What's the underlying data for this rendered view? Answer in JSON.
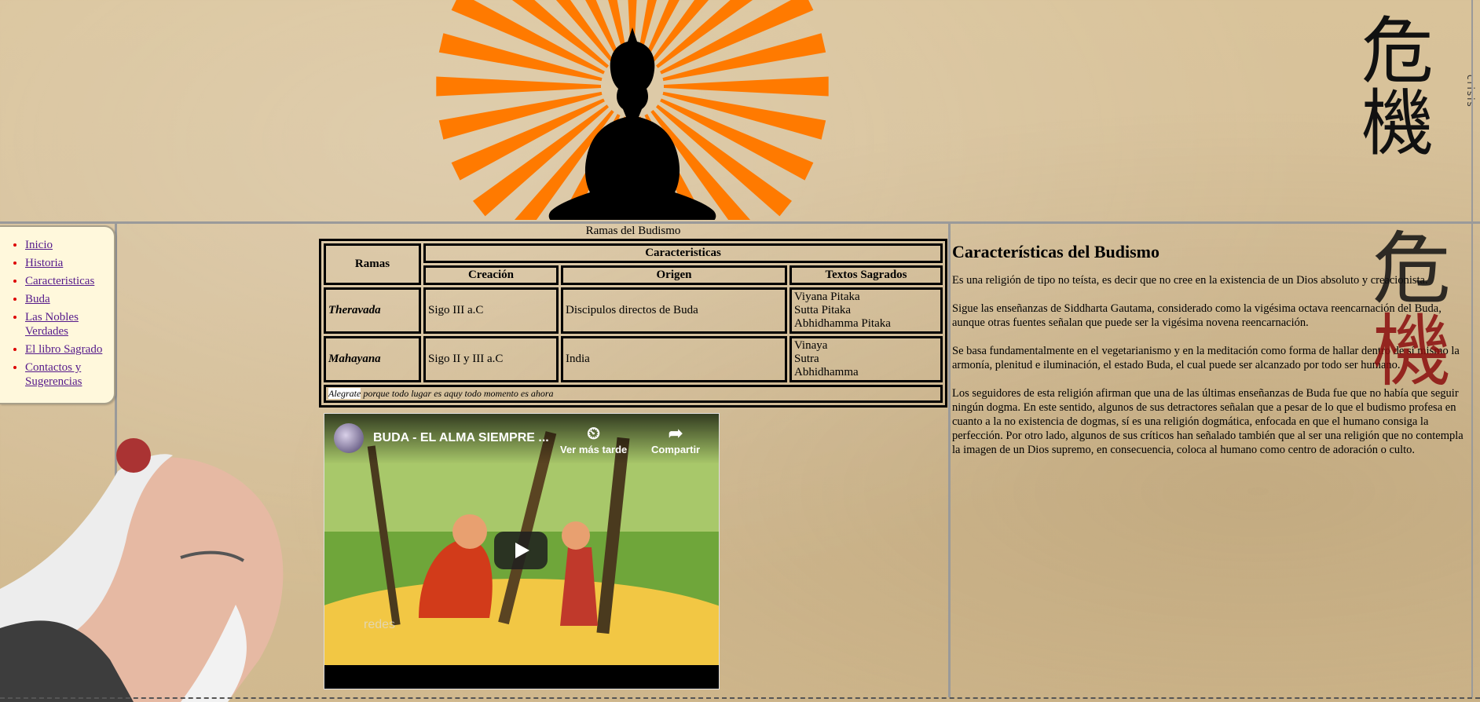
{
  "header": {
    "kanji": [
      "危",
      "機"
    ],
    "kanji_secondary": [
      "危",
      "機"
    ],
    "side_text": "crisis"
  },
  "sidebar": {
    "items": [
      {
        "label": "Inicio"
      },
      {
        "label": "Historia"
      },
      {
        "label": "Caracteristicas"
      },
      {
        "label": "Buda"
      },
      {
        "label": "Las Nobles Verdades"
      },
      {
        "label": "El libro Sagrado"
      },
      {
        "label": "Contactos y Sugerencias"
      }
    ]
  },
  "table": {
    "caption": "Ramas del Budismo",
    "headers": {
      "ramas": "Ramas",
      "caracteristicas": "Caracteristicas",
      "creacion": "Creación",
      "origen": "Origen",
      "textos": "Textos Sagrados"
    },
    "rows": [
      {
        "rama": "Theravada",
        "creacion": "Sigo III a.C",
        "origen": "Discipulos directos de Buda",
        "textos": [
          "Viyana Pitaka",
          "Sutta Pitaka",
          "Abhidhamma Pitaka"
        ]
      },
      {
        "rama": "Mahayana",
        "creacion": "Sigo II y III a.C",
        "origen": "India",
        "textos": [
          "Vinaya",
          "Sutra",
          "Abhidhamma"
        ]
      }
    ],
    "footer_highlight": "Alegrate",
    "footer_rest": " porque todo lugar es aquy todo momento es ahora"
  },
  "video": {
    "title": "BUDA - EL ALMA SIEMPRE ...",
    "watch_later": "Ver más tarde",
    "share": "Compartir",
    "watermark": "redes"
  },
  "article": {
    "title": "Características del Budismo",
    "paragraphs": [
      "Es una religión de tipo no teísta, es decir que no cree en la existencia de un Dios absoluto y creacionista.",
      "Sigue las enseñanzas de Siddharta Gautama, considerado como la vigésima octava reencarnación del Buda, aunque otras fuentes señalan que puede ser la vigésima novena reencarnación.",
      "Se basa fundamentalmente en el vegetarianismo y en la meditación como forma de hallar dentro de sí mismo la armonía, plenitud e iluminación, el estado Buda, el cual puede ser alcanzado por todo ser humano.",
      "Los seguidores de esta religión afirman que una de las últimas enseñanzas de Buda fue que no había que seguir ningún dogma. En este sentido, algunos de sus detractores señalan que a pesar de lo que el budismo profesa en cuanto a la no existencia de dogmas, sí es una religión dogmática, enfocada en que el humano consiga la perfección. Por otro lado, algunos de sus críticos han señalado también que al ser una religión que no contempla la imagen de un Dios supremo, en consecuencia, coloca al humano como centro de adoración o culto."
    ]
  },
  "colors": {
    "sun_orange": "#ff7a00",
    "background": "#d6c09a",
    "sidebar_bg": "#fff8dc",
    "bullet_red": "#dd0000",
    "link": "#551a8b",
    "kanji_red": "#8b0d0d"
  }
}
